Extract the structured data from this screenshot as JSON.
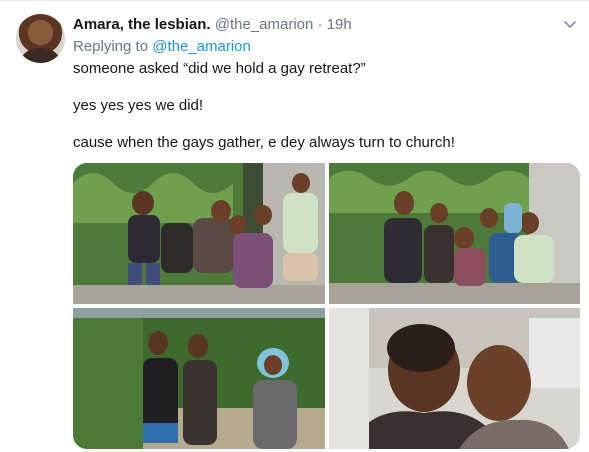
{
  "tweet": {
    "display_name": "Amara, the lesbian.",
    "handle": "@the_amarion",
    "separator": "·",
    "time": "19h",
    "reply_prefix": "Replying to",
    "reply_to": "@the_amarion",
    "lines": [
      "someone asked “did we hold a gay retreat?”",
      "yes yes yes we did!",
      "cause when the gays gather, e dey always turn to church!"
    ]
  },
  "icons": {
    "caret": "chevron-down-icon"
  },
  "colors": {
    "text": "#14171a",
    "secondary": "#657786",
    "link": "#1b95e0",
    "border": "#e6ecf0"
  }
}
